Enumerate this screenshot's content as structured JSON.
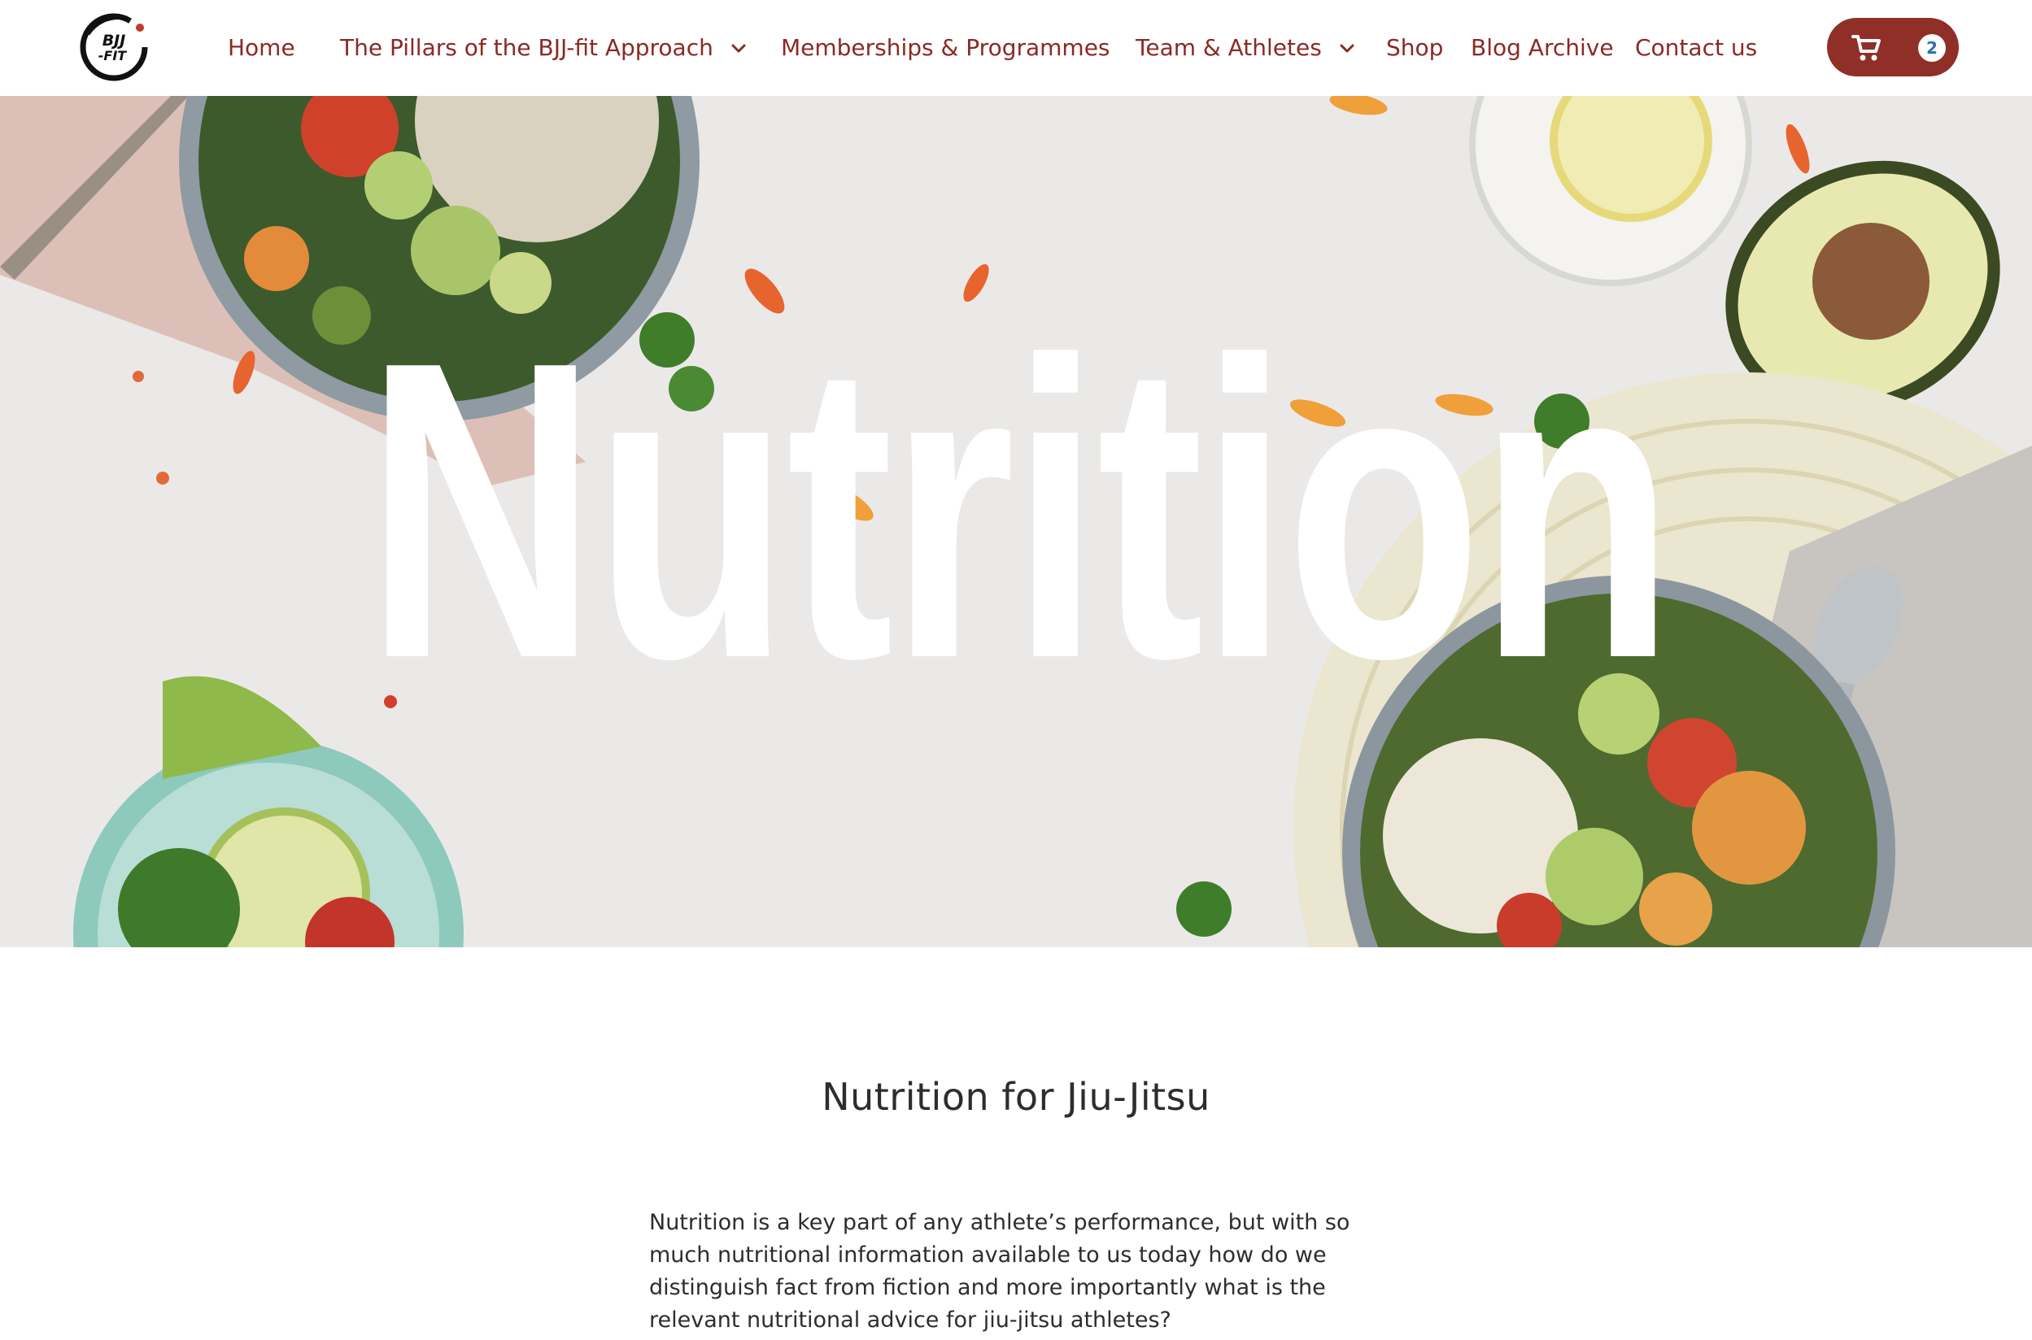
{
  "brand": {
    "logo_text": "BJJ-FIT"
  },
  "nav": {
    "items": [
      {
        "label": "Home",
        "has_dropdown": false
      },
      {
        "label": "The Pillars of the BJJ-fit Approach",
        "has_dropdown": true
      },
      {
        "label": "Memberships & Programmes",
        "has_dropdown": false
      },
      {
        "label": "Team & Athletes",
        "has_dropdown": true
      },
      {
        "label": "Shop",
        "has_dropdown": false
      },
      {
        "label": "Blog Archive",
        "has_dropdown": false
      },
      {
        "label": "Contact us",
        "has_dropdown": false
      }
    ],
    "cart": {
      "icon": "shopping-cart-icon",
      "count": "2"
    }
  },
  "hero": {
    "title": "Nutrition"
  },
  "main": {
    "heading": "Nutrition for Jiu-Jitsu",
    "intro": "Nutrition is a key part of any athlete’s performance, but with so much nutritional information available to us today how do we distinguish fact from fiction and more importantly what is the relevant nutritional advice for jiu-jitsu athletes?"
  },
  "colors": {
    "accent": "#8f2f28",
    "nav_text": "#8a2a26",
    "badge_text": "#2a6fb0"
  }
}
